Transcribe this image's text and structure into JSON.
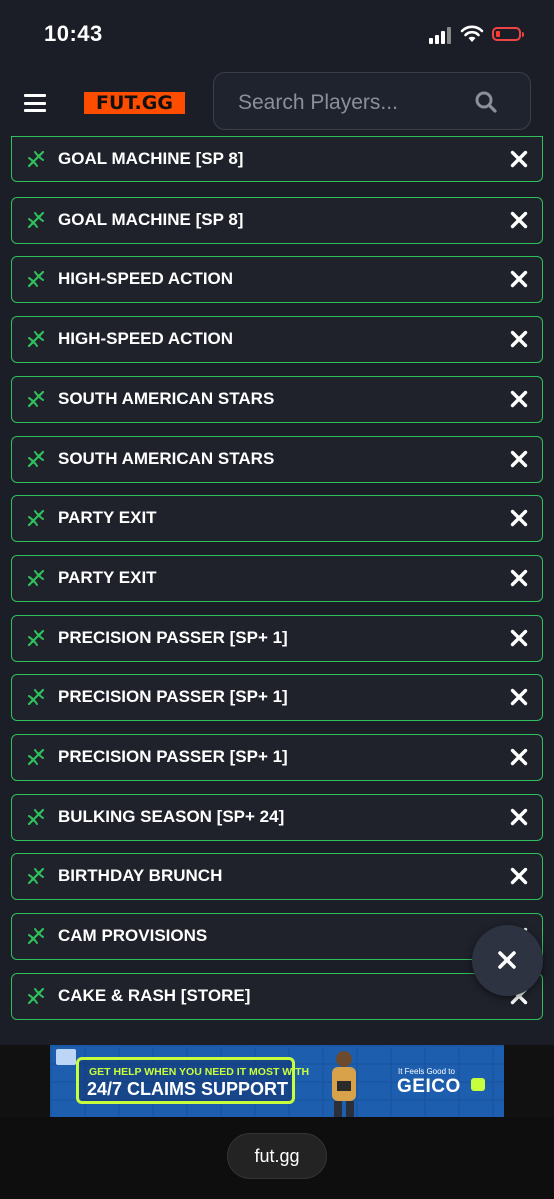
{
  "status_bar": {
    "time": "10:43",
    "battery_color": "#ff3b30"
  },
  "header": {
    "logo_text": "FUT.GG",
    "logo_color": "#ff4d00",
    "search_placeholder": "Search Players..."
  },
  "accent_green": "#2fbf5b",
  "items": [
    {
      "label": "GOAL MACHINE [SP 8]"
    },
    {
      "label": "GOAL MACHINE [SP 8]"
    },
    {
      "label": "HIGH-SPEED ACTION"
    },
    {
      "label": "HIGH-SPEED ACTION"
    },
    {
      "label": "SOUTH AMERICAN STARS"
    },
    {
      "label": "SOUTH AMERICAN STARS"
    },
    {
      "label": "PARTY EXIT"
    },
    {
      "label": "PARTY EXIT"
    },
    {
      "label": "PRECISION PASSER [SP+ 1]"
    },
    {
      "label": "PRECISION PASSER [SP+ 1]"
    },
    {
      "label": "PRECISION PASSER [SP+ 1]"
    },
    {
      "label": "BULKING SEASON [SP+ 24]"
    },
    {
      "label": "BIRTHDAY BRUNCH"
    },
    {
      "label": "CAM PROVISIONS"
    },
    {
      "label": "CAKE & RASH [STORE]"
    }
  ],
  "ad": {
    "line1": "GET HELP WHEN YOU NEED IT MOST WITH",
    "line2": "24/7 CLAIMS SUPPORT",
    "tagline": "It Feels Good to",
    "brand": "GEICO"
  },
  "bottom_bar": {
    "url": "fut.gg"
  }
}
